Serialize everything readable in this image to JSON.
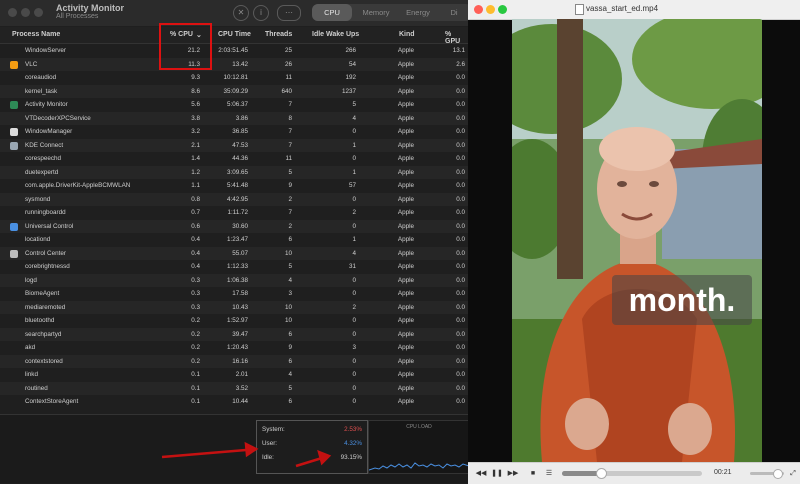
{
  "activity_monitor": {
    "title": "Activity Monitor",
    "subtitle": "All Processes",
    "tabs": [
      {
        "label": "CPU",
        "active": true
      },
      {
        "label": "Memory",
        "active": false
      },
      {
        "label": "Energy",
        "active": false
      },
      {
        "label": "Di",
        "active": false
      }
    ],
    "columns": [
      "Process Name",
      "% CPU",
      "CPU Time",
      "Threads",
      "Idle Wake Ups",
      "Kind",
      "% GPU"
    ],
    "sort_indicator": "⌄",
    "rows": [
      {
        "name": "WindowServer",
        "cpu": "21.2",
        "time": "2:03:51.45",
        "threads": "25",
        "wake": "266",
        "kind": "Apple",
        "gpu": "13.1",
        "icon": ""
      },
      {
        "name": "VLC",
        "cpu": "11.3",
        "time": "13.42",
        "threads": "26",
        "wake": "54",
        "kind": "Apple",
        "gpu": "2.6",
        "icon": "vlc-icon"
      },
      {
        "name": "coreaudiod",
        "cpu": "9.3",
        "time": "10:12.81",
        "threads": "11",
        "wake": "192",
        "kind": "Apple",
        "gpu": "0.0",
        "icon": ""
      },
      {
        "name": "kernel_task",
        "cpu": "8.6",
        "time": "35:09.29",
        "threads": "640",
        "wake": "1237",
        "kind": "Apple",
        "gpu": "0.0",
        "icon": ""
      },
      {
        "name": "Activity Monitor",
        "cpu": "5.6",
        "time": "5:06.37",
        "threads": "7",
        "wake": "5",
        "kind": "Apple",
        "gpu": "0.0",
        "icon": "activity-monitor-icon"
      },
      {
        "name": "VTDecoderXPCService",
        "cpu": "3.8",
        "time": "3.86",
        "threads": "8",
        "wake": "4",
        "kind": "Apple",
        "gpu": "0.0",
        "icon": ""
      },
      {
        "name": "WindowManager",
        "cpu": "3.2",
        "time": "36.85",
        "threads": "7",
        "wake": "0",
        "kind": "Apple",
        "gpu": "0.0",
        "icon": "window-manager-icon"
      },
      {
        "name": "KDE Connect",
        "cpu": "2.1",
        "time": "47.53",
        "threads": "7",
        "wake": "1",
        "kind": "Apple",
        "gpu": "0.0",
        "icon": "kde-connect-icon"
      },
      {
        "name": "corespeechd",
        "cpu": "1.4",
        "time": "44.36",
        "threads": "11",
        "wake": "0",
        "kind": "Apple",
        "gpu": "0.0",
        "icon": ""
      },
      {
        "name": "duetexpertd",
        "cpu": "1.2",
        "time": "3:09.65",
        "threads": "5",
        "wake": "1",
        "kind": "Apple",
        "gpu": "0.0",
        "icon": ""
      },
      {
        "name": "com.apple.DriverKit-AppleBCMWLAN",
        "cpu": "1.1",
        "time": "5:41.48",
        "threads": "9",
        "wake": "57",
        "kind": "Apple",
        "gpu": "0.0",
        "icon": ""
      },
      {
        "name": "sysmond",
        "cpu": "0.8",
        "time": "4:42.95",
        "threads": "2",
        "wake": "0",
        "kind": "Apple",
        "gpu": "0.0",
        "icon": ""
      },
      {
        "name": "runningboardd",
        "cpu": "0.7",
        "time": "1:11.72",
        "threads": "7",
        "wake": "2",
        "kind": "Apple",
        "gpu": "0.0",
        "icon": ""
      },
      {
        "name": "Universal Control",
        "cpu": "0.6",
        "time": "30.60",
        "threads": "2",
        "wake": "0",
        "kind": "Apple",
        "gpu": "0.0",
        "icon": "universal-control-icon"
      },
      {
        "name": "locationd",
        "cpu": "0.4",
        "time": "1:23.47",
        "threads": "6",
        "wake": "1",
        "kind": "Apple",
        "gpu": "0.0",
        "icon": ""
      },
      {
        "name": "Control Center",
        "cpu": "0.4",
        "time": "55.07",
        "threads": "10",
        "wake": "4",
        "kind": "Apple",
        "gpu": "0.0",
        "icon": "control-center-icon"
      },
      {
        "name": "corebrightnessd",
        "cpu": "0.4",
        "time": "1:12.33",
        "threads": "5",
        "wake": "31",
        "kind": "Apple",
        "gpu": "0.0",
        "icon": ""
      },
      {
        "name": "logd",
        "cpu": "0.3",
        "time": "1:06.38",
        "threads": "4",
        "wake": "0",
        "kind": "Apple",
        "gpu": "0.0",
        "icon": ""
      },
      {
        "name": "BiomeAgent",
        "cpu": "0.3",
        "time": "17.58",
        "threads": "3",
        "wake": "0",
        "kind": "Apple",
        "gpu": "0.0",
        "icon": ""
      },
      {
        "name": "mediaremoted",
        "cpu": "0.3",
        "time": "10.43",
        "threads": "10",
        "wake": "2",
        "kind": "Apple",
        "gpu": "0.0",
        "icon": ""
      },
      {
        "name": "bluetoothd",
        "cpu": "0.2",
        "time": "1:52.97",
        "threads": "10",
        "wake": "0",
        "kind": "Apple",
        "gpu": "0.0",
        "icon": ""
      },
      {
        "name": "searchpartyd",
        "cpu": "0.2",
        "time": "39.47",
        "threads": "6",
        "wake": "0",
        "kind": "Apple",
        "gpu": "0.0",
        "icon": ""
      },
      {
        "name": "akd",
        "cpu": "0.2",
        "time": "1:20.43",
        "threads": "9",
        "wake": "3",
        "kind": "Apple",
        "gpu": "0.0",
        "icon": ""
      },
      {
        "name": "contextstored",
        "cpu": "0.2",
        "time": "16.16",
        "threads": "6",
        "wake": "0",
        "kind": "Apple",
        "gpu": "0.0",
        "icon": ""
      },
      {
        "name": "linkd",
        "cpu": "0.1",
        "time": "2.01",
        "threads": "4",
        "wake": "0",
        "kind": "Apple",
        "gpu": "0.0",
        "icon": ""
      },
      {
        "name": "routined",
        "cpu": "0.1",
        "time": "3.52",
        "threads": "5",
        "wake": "0",
        "kind": "Apple",
        "gpu": "0.0",
        "icon": ""
      },
      {
        "name": "ContextStoreAgent",
        "cpu": "0.1",
        "time": "10.44",
        "threads": "6",
        "wake": "0",
        "kind": "Apple",
        "gpu": "0.0",
        "icon": ""
      }
    ],
    "stats": {
      "system_label": "System:",
      "system_value": "2.53%",
      "user_label": "User:",
      "user_value": "4.32%",
      "idle_label": "Idle:",
      "idle_value": "93.15%"
    },
    "cpu_load_title": "CPU LOAD",
    "colors": {
      "system": "#e05050",
      "user": "#4a90e2",
      "highlight": "#d11111"
    }
  },
  "vlc": {
    "title": "vassa_start_ed.mp4",
    "caption": "month.",
    "time": "00:21",
    "progress": 0.27,
    "volume": 0.8
  }
}
